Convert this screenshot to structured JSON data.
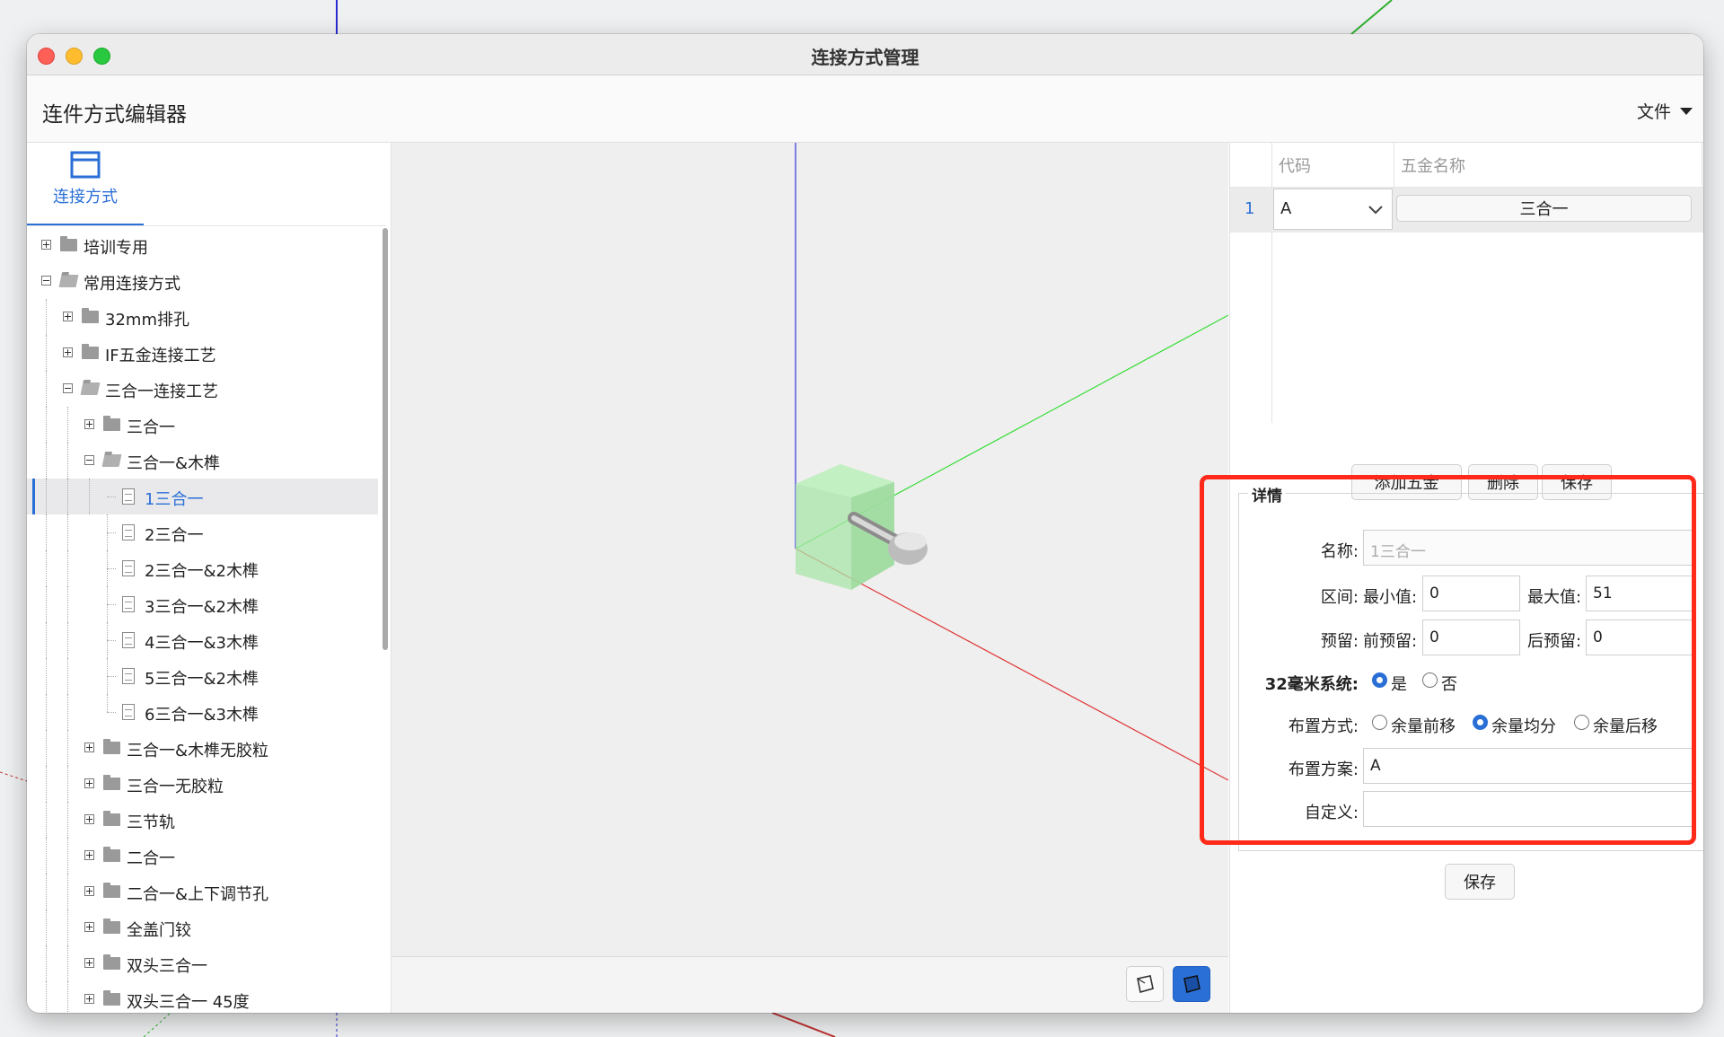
{
  "window": {
    "title": "连接方式管理"
  },
  "app": {
    "title": "连件方式编辑器",
    "file_menu": "文件"
  },
  "left": {
    "tab_label": "连接方式"
  },
  "tree": [
    {
      "label": "培训专用"
    },
    {
      "label": "常用连接方式"
    },
    {
      "label": "32mm排孔"
    },
    {
      "label": "IF五金连接工艺"
    },
    {
      "label": "三合一连接工艺"
    },
    {
      "label": "三合一"
    },
    {
      "label": "三合一&木榫"
    },
    {
      "label": "1三合一"
    },
    {
      "label": "2三合一"
    },
    {
      "label": "2三合一&2木榫"
    },
    {
      "label": "3三合一&2木榫"
    },
    {
      "label": "4三合一&3木榫"
    },
    {
      "label": "5三合一&2木榫"
    },
    {
      "label": "6三合一&3木榫"
    },
    {
      "label": "三合一&木榫无胶粒"
    },
    {
      "label": "三合一无胶粒"
    },
    {
      "label": "三节轨"
    },
    {
      "label": "二合一"
    },
    {
      "label": "二合一&上下调节孔"
    },
    {
      "label": "全盖门铰"
    },
    {
      "label": "双头三合一"
    },
    {
      "label": "双头三合一 45度"
    }
  ],
  "grid": {
    "columns": [
      "代码",
      "五金名称"
    ],
    "rows": [
      {
        "num": "1",
        "code": "A",
        "name": "三合一"
      }
    ]
  },
  "buttons": {
    "add": "添加五金",
    "delete": "删除",
    "save_top": "保存",
    "save_bottom": "保存"
  },
  "detail": {
    "legend": "详情",
    "name_label": "名称:",
    "name_value": "1三合一",
    "range_label": "区间:",
    "min_label": "最小值:",
    "min_value": "0",
    "max_label": "最大值:",
    "max_value": "51",
    "reserve_label": "预留:",
    "front_label": "前预留:",
    "front_value": "0",
    "back_label": "后预留:",
    "back_value": "0",
    "system_label": "32毫米系统:",
    "yes": "是",
    "no": "否",
    "layout_label": "布置方式:",
    "layout_options": [
      "余量前移",
      "余量均分",
      "余量后移"
    ],
    "plan_label": "布置方案:",
    "plan_value": "A",
    "custom_label": "自定义:",
    "custom_value": ""
  },
  "state": {
    "system_32mm": "是",
    "layout": "余量均分"
  },
  "colors": {
    "accent": "#2a6fd6",
    "highlight_box": "#ff2a1a",
    "axis_x": "#e03030",
    "axis_y": "#30d030",
    "axis_z": "#3030e0"
  }
}
